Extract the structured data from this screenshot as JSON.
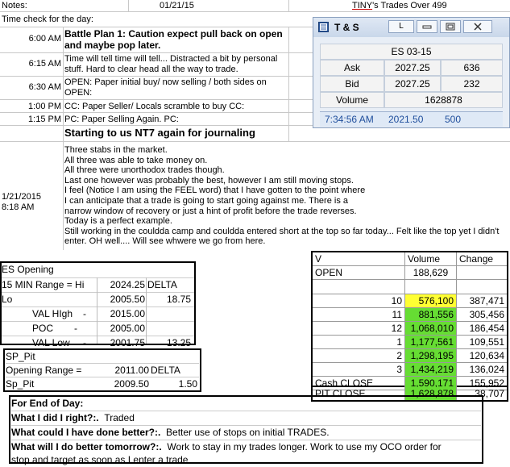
{
  "header": {
    "notes_label": "Notes:",
    "date": "01/21/15",
    "tiny_title": "TINY's Trades Over 499",
    "time_check_label": "Time check for the day:"
  },
  "schedule": [
    {
      "time": "6:00 AM",
      "text": "Battle Plan 1: Caution expect pull back on open and maybe pop later."
    },
    {
      "time": "6:15 AM",
      "text": "Time will tell time will tell... Distracted a bit by personal stuff.  Hard to clear head all the way to trade."
    },
    {
      "time": "6:30 AM",
      "text": "OPEN: Paper initial buy/ now selling / both sides on OPEN:"
    },
    {
      "time": "1:00 PM",
      "text": "CC: Paper Seller/ Locals scramble to buy CC:"
    },
    {
      "time": "1:15 PM",
      "text": "PC: Paper Selling Again. PC:"
    }
  ],
  "journal_heading": "Starting to us NT7 again for journaling",
  "journal": {
    "date": "1/21/2015",
    "time": "8:18 AM",
    "lines": [
      "Three stabs in the market.",
      "All three was able to take money on.",
      "All three were unorthodox trades though.",
      "Last one however was probably the best, however I am still moving stops.",
      "I feel (Notice I am using the FEEL word) that I have gotten to the point where",
      "I can anticipate that a trade is going to start going against me.  There is a",
      "narrow window of recovery or just a hint of profit before the trade reverses.",
      "Today is a perfect example.",
      "Still working in the couldda camp and couldda entered short at the top so far today... Felt like the top yet I didn't",
      "enter.  OH well.... Will see whwere we go from here."
    ]
  },
  "ts_window": {
    "title": "T & S",
    "btn_l": "L",
    "symbol": "ES 03-15",
    "ask_label": "Ask",
    "ask_price": "2027.25",
    "ask_size": "636",
    "bid_label": "Bid",
    "bid_price": "2027.25",
    "bid_size": "232",
    "volume_label": "Volume",
    "volume": "1628878",
    "tick_time": "7:34:56 AM",
    "tick_price": "2021.50",
    "tick_size": "500"
  },
  "es_opening": {
    "title": "ES Opening",
    "range_label": "15 MIN Range = Hi",
    "range_hi": "2024.25",
    "delta_label": "DELTA",
    "lo_label": "Lo",
    "lo_value": "2005.50",
    "lo_delta": "18.75",
    "val_high_label": "VAL HIgh",
    "val_high_dash": "-",
    "val_high": "2015.00",
    "poc_label": "POC",
    "poc_dash": "-",
    "poc": "2005.00",
    "val_low_label": "VAL Low",
    "val_low_dash": "-",
    "val_low": "2001.75",
    "val_low_delta": "13.25"
  },
  "sp_pit": {
    "title": "SP_Pit",
    "range_label": "Opening Range =",
    "range_value": "2011.00",
    "delta_label": "DELTA",
    "sp_label": "Sp_Pit",
    "sp_value": "2009.50",
    "sp_delta": "1.50"
  },
  "volume_table": {
    "headers": [
      "V",
      "Volume",
      "Change"
    ],
    "open_row": {
      "label": "OPEN",
      "volume": "188,629",
      "change": ""
    },
    "rows": [
      {
        "hour": "10",
        "volume": "576,100",
        "change": "387,471",
        "fill": "yellow"
      },
      {
        "hour": "11",
        "volume": "881,556",
        "change": "305,456",
        "fill": "green"
      },
      {
        "hour": "12",
        "volume": "1,068,010",
        "change": "186,454",
        "fill": "green"
      },
      {
        "hour": "1",
        "volume": "1,177,561",
        "change": "109,551",
        "fill": "green"
      },
      {
        "hour": "2",
        "volume": "1,298,195",
        "change": "120,634",
        "fill": "green"
      },
      {
        "hour": "3",
        "volume": "1,434,219",
        "change": "136,024",
        "fill": "green"
      }
    ],
    "cash_close": {
      "label": "Cash CLOSE",
      "volume": "1,590,171",
      "change": "155,952"
    },
    "pit_close": {
      "label": "PIT CLOSE",
      "volume": "1,628,878",
      "change": "38,707"
    }
  },
  "end_of_day": {
    "title": "For End of Day:",
    "q1": "What I did I right?:.",
    "a1": "Traded",
    "q2": "What could I have done better?:.",
    "a2": "Better use of stops on initial TRADES.",
    "q3": "What will I do better tomorrow?:.",
    "a3": "Work to stay in my trades longer.  Work to use my OCO order for",
    "a3b": "stop and target as soon as I enter a trade"
  },
  "colors": {
    "yellow": "#ffff33",
    "green": "#66dd33",
    "ts_blue": "#1f4e9c"
  }
}
